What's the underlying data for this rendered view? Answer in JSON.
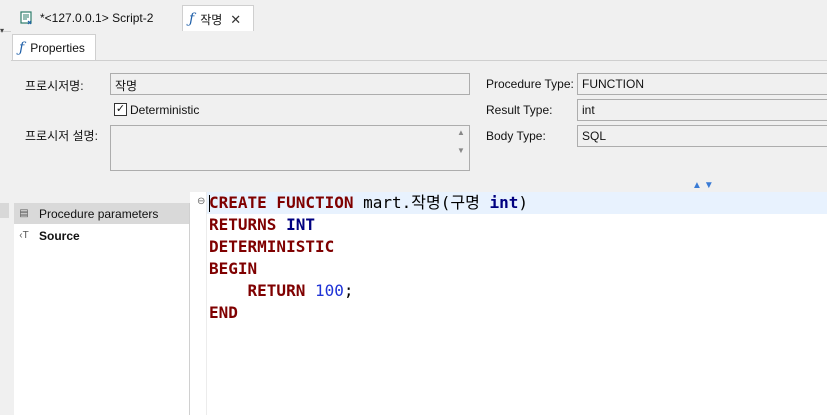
{
  "tabs": {
    "script_label": "*<127.0.0.1> Script-2",
    "function_label": "작명",
    "close_glyph": "✕"
  },
  "panel": {
    "tab_label": "Properties"
  },
  "form": {
    "procedure_name_label": "프로시저명:",
    "procedure_name_value": "작명",
    "deterministic_label": "Deterministic",
    "deterministic_checked": true,
    "description_label": "프로시저 설명:",
    "description_value": "",
    "procedure_type_label": "Procedure Type:",
    "procedure_type_value": "FUNCTION",
    "result_type_label": "Result Type:",
    "result_type_value": "int",
    "body_type_label": "Body Type:",
    "body_type_value": "SQL"
  },
  "nav": {
    "items": [
      {
        "label": "Procedure parameters",
        "icon": "table-icon"
      },
      {
        "label": "Source",
        "icon": "source-icon"
      }
    ]
  },
  "code": {
    "line1": {
      "kw": "CREATE FUNCTION",
      "name": " mart.작명(구명 ",
      "type": "int",
      "close": ")"
    },
    "line2": {
      "kw": "RETURNS",
      "type": " INT"
    },
    "line3": {
      "kw": "DETERMINISTIC"
    },
    "line4": {
      "kw": "BEGIN"
    },
    "line5": {
      "indent": "    ",
      "kw": "RETURN",
      "num": " 100",
      "end": ";"
    },
    "line6": {
      "kw": "END"
    }
  },
  "colors": {
    "keyword": "#7f0000",
    "type_keyword": "#000080",
    "number": "#1f33d6",
    "icon_blue": "#1f5fa8"
  }
}
